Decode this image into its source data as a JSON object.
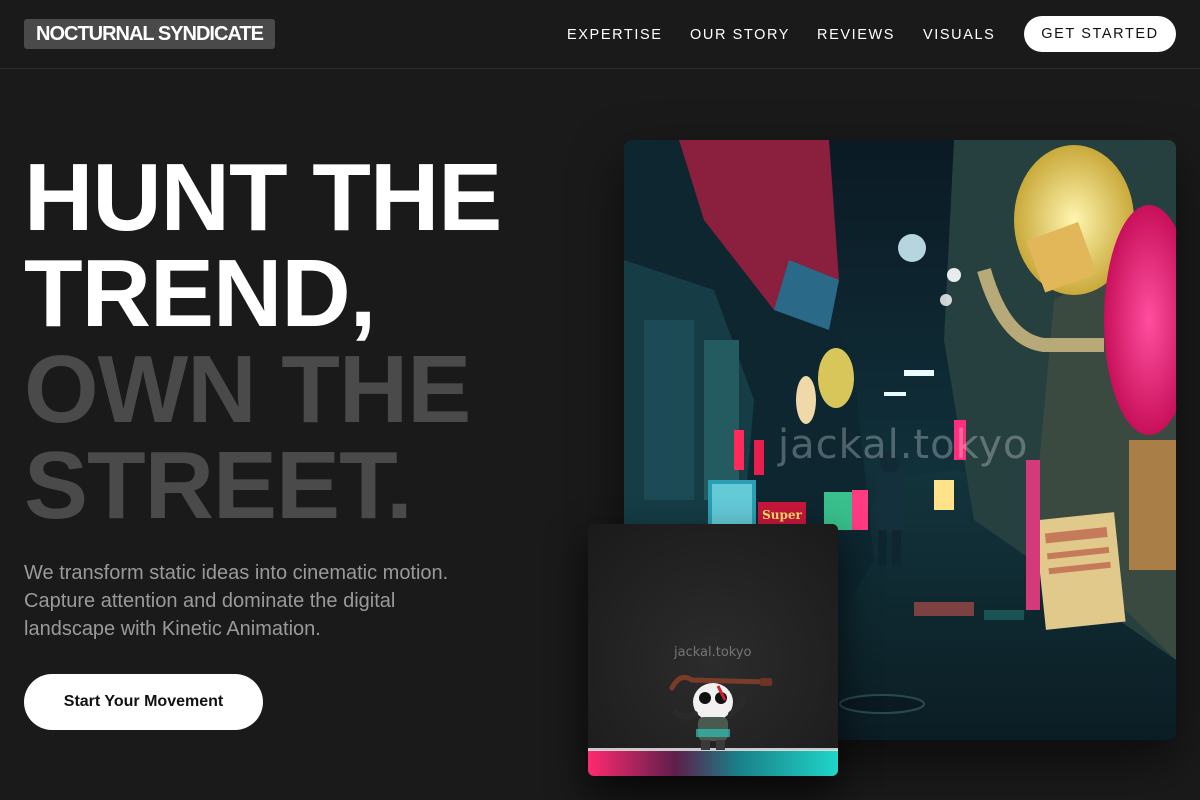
{
  "brand": {
    "name": "NOCTURNAL SYNDICATE"
  },
  "nav": {
    "items": [
      "EXPERTISE",
      "OUR STORY",
      "REVIEWS",
      "VISUALS"
    ],
    "cta_label": "GET STARTED"
  },
  "hero": {
    "headline_bright": [
      "HUNT THE",
      "TREND,"
    ],
    "headline_dim": [
      "OWN THE",
      "STREET."
    ],
    "subtext_lines": [
      "We transform static ideas into cinematic motion.",
      "Capture attention and dominate the digital",
      "landscape with Kinetic Animation."
    ],
    "button_label": "Start Your Movement"
  },
  "visuals": {
    "main_watermark": "jackal.tokyo",
    "small_watermark": "jackal.tokyo",
    "main_sign_text": "Super"
  },
  "colors": {
    "background": "#1a1a1a",
    "headline_dim": "#4a4a4a",
    "subtext": "#9a9a9a",
    "button_bg": "#ffffff",
    "neon_pink": "#ff1f7a",
    "neon_teal": "#1fd6c8"
  }
}
